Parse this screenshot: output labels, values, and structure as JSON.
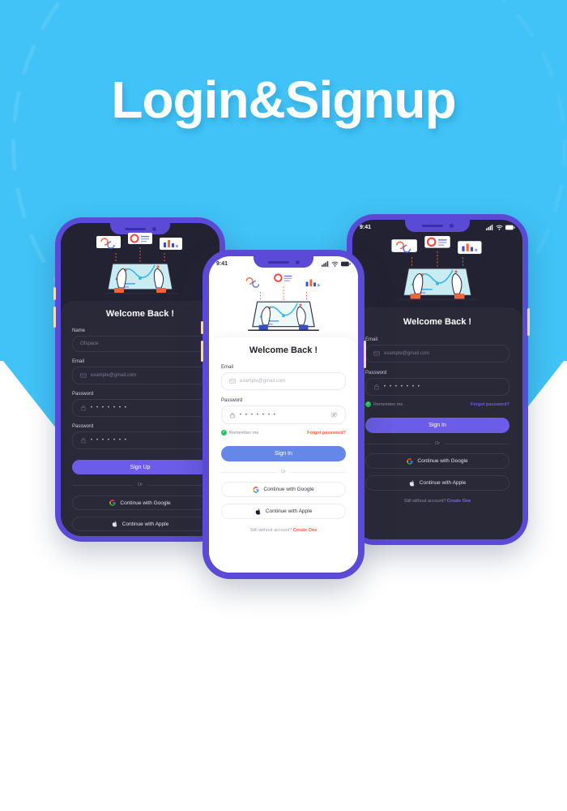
{
  "poster": {
    "title": "Login&Signup",
    "background_color": "#41c3f7",
    "accent_purple": "#6c5ce7",
    "accent_blue": "#6487e8",
    "accent_orange": "#f4633a",
    "accent_green": "#22c55e"
  },
  "status_bar": {
    "time": "9:41",
    "signal_icon": "cellular-signal-icon",
    "wifi_icon": "wifi-icon",
    "battery_icon": "battery-icon"
  },
  "common": {
    "or_label": "Or",
    "google_label": "Continue with Google",
    "apple_label": "Continue with Apple",
    "google_icon": "google-logo-icon",
    "apple_icon": "apple-logo-icon",
    "email_icon": "envelope-icon",
    "lock_icon": "lock-icon",
    "eye_off_icon": "eye-off-icon",
    "illustration": "person-hands-laptop-analytics-illustration"
  },
  "signup_screen": {
    "theme": "dark",
    "title": "Welcome Back !",
    "name_label": "Name",
    "name_value": "Ofspace",
    "email_label": "Email",
    "email_placeholder": "example@gmail.com",
    "password_label": "Password",
    "password_value": "• • • • • • •",
    "confirm_password_label": "Password",
    "confirm_password_value": "• • • • • • •",
    "submit_label": "Sign Up",
    "or_label": "Or",
    "google_label": "Continue with Google",
    "apple_label": "Continue with Apple"
  },
  "login_light_screen": {
    "theme": "light",
    "title": "Welcome Back !",
    "email_label": "Email",
    "email_placeholder": "example@gmail.com",
    "password_label": "Password",
    "password_value": "• • • • • • •",
    "remember_label": "Remember me",
    "forgot_label": "Forgot password?",
    "submit_label": "Sign In",
    "or_label": "Or",
    "google_label": "Continue with Google",
    "apple_label": "Continue with Apple",
    "footer_text": "Still without account?",
    "footer_link": "Create One"
  },
  "login_dark_screen": {
    "theme": "dark",
    "title": "Welcome Back !",
    "email_label": "Email",
    "email_placeholder": "example@gmail.com",
    "password_label": "Password",
    "password_value": "• • • • • • •",
    "remember_label": "Remember me",
    "forgot_label": "Forgot password?",
    "submit_label": "Sign In",
    "or_label": "Or",
    "google_label": "Continue with Google",
    "apple_label": "Continue with Apple",
    "footer_text": "Still without account?",
    "footer_link": "Create One"
  }
}
